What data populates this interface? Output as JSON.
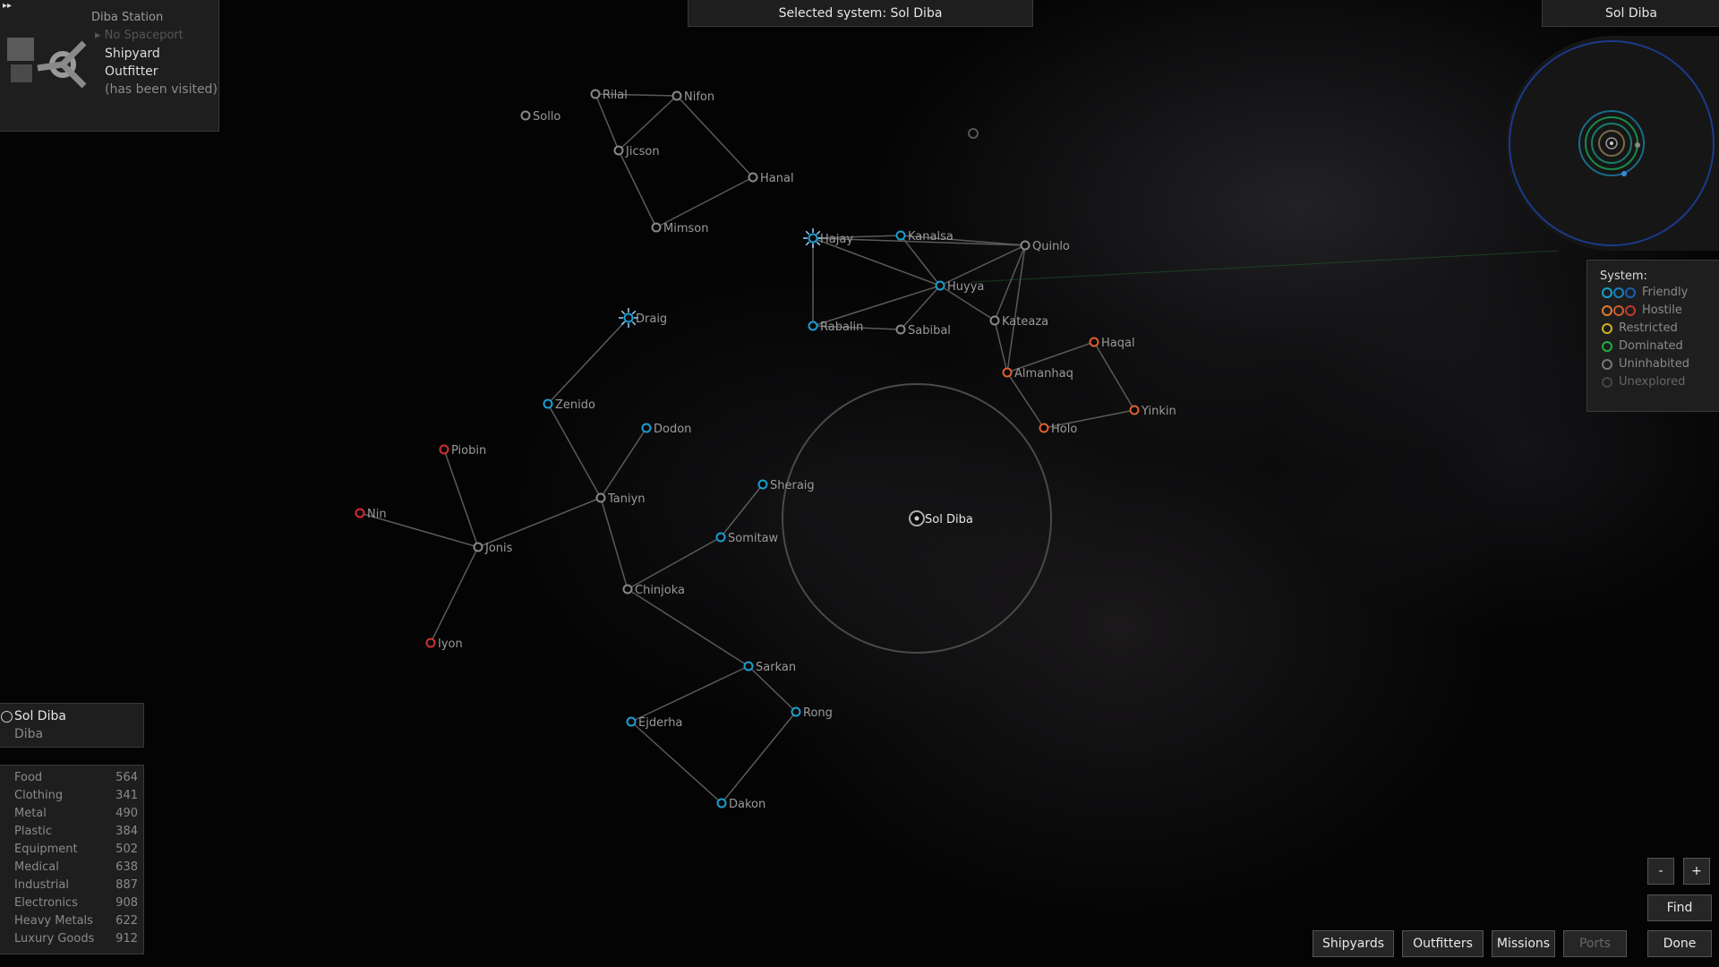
{
  "top_bar": {
    "selected_label": "Selected system: Sol Diba"
  },
  "planet_panel": {
    "station": "Diba Station",
    "spaceport": "No Spaceport",
    "shipyard": "Shipyard",
    "outfitter": "Outfitter",
    "visited": "(has been visited)"
  },
  "orbit_panel": {
    "title": "Sol Diba"
  },
  "legend": {
    "title": "System:",
    "items": [
      {
        "label": "Friendly",
        "colors": [
          "#1a9fd0",
          "#1a7fc0",
          "#1a5fb0"
        ]
      },
      {
        "label": "Hostile",
        "colors": [
          "#e07a30",
          "#d05a2a",
          "#c03a2a"
        ]
      },
      {
        "label": "Restricted",
        "colors": [
          "#d0b020"
        ]
      },
      {
        "label": "Dominated",
        "colors": [
          "#20b040"
        ]
      },
      {
        "label": "Uninhabited",
        "colors": [
          "#777777"
        ]
      },
      {
        "label": "Unexplored",
        "colors": [
          "#444444"
        ]
      }
    ]
  },
  "system_info": {
    "name": "Sol Diba",
    "government": "Diba"
  },
  "trade": [
    {
      "name": "Food",
      "price": "564"
    },
    {
      "name": "Clothing",
      "price": "341"
    },
    {
      "name": "Metal",
      "price": "490"
    },
    {
      "name": "Plastic",
      "price": "384"
    },
    {
      "name": "Equipment",
      "price": "502"
    },
    {
      "name": "Medical",
      "price": "638"
    },
    {
      "name": "Industrial",
      "price": "887"
    },
    {
      "name": "Electronics",
      "price": "908"
    },
    {
      "name": "Heavy Metals",
      "price": "622"
    },
    {
      "name": "Luxury Goods",
      "price": "912"
    }
  ],
  "zoom": {
    "minus": "-",
    "plus": "+"
  },
  "buttons": {
    "find": "Find",
    "shipyards": "Shipyards",
    "outfitters": "Outfitters",
    "missions": "Missions",
    "ports": "Ports",
    "done": "Done"
  },
  "colors": {
    "friendly": "#1a9fd0",
    "hostile_red": "#d03030",
    "hostile_orange": "#e06030",
    "uninhabited": "#888888",
    "selected": "#aaaaaa"
  },
  "systems": [
    {
      "name": "Sollo",
      "type": "uninhabited"
    },
    {
      "name": "Rilal",
      "type": "uninhabited"
    },
    {
      "name": "Nifon",
      "type": "uninhabited"
    },
    {
      "name": "Jicson",
      "type": "uninhabited"
    },
    {
      "name": "Hanal",
      "type": "uninhabited"
    },
    {
      "name": "Mimson",
      "type": "uninhabited"
    },
    {
      "name": "Hajay",
      "type": "friendly"
    },
    {
      "name": "Kanalsa",
      "type": "friendly"
    },
    {
      "name": "Quinlo",
      "type": "uninhabited"
    },
    {
      "name": "Huyya",
      "type": "friendly"
    },
    {
      "name": "Rabalin",
      "type": "friendly"
    },
    {
      "name": "Sabibal",
      "type": "uninhabited"
    },
    {
      "name": "Kateaza",
      "type": "uninhabited"
    },
    {
      "name": "Haqal",
      "type": "hostile_orange"
    },
    {
      "name": "Almanhaq",
      "type": "hostile_orange"
    },
    {
      "name": "Yinkin",
      "type": "hostile_orange"
    },
    {
      "name": "Holo",
      "type": "hostile_orange"
    },
    {
      "name": "Draig",
      "type": "friendly"
    },
    {
      "name": "Zenido",
      "type": "friendly"
    },
    {
      "name": "Dodon",
      "type": "friendly"
    },
    {
      "name": "Piobin",
      "type": "hostile_red"
    },
    {
      "name": "Nin",
      "type": "hostile_red"
    },
    {
      "name": "Jonis",
      "type": "uninhabited"
    },
    {
      "name": "Taniyn",
      "type": "uninhabited"
    },
    {
      "name": "Sheraig",
      "type": "friendly"
    },
    {
      "name": "Somitaw",
      "type": "friendly"
    },
    {
      "name": "Chinjoka",
      "type": "uninhabited"
    },
    {
      "name": "Iyon",
      "type": "hostile_red"
    },
    {
      "name": "Sarkan",
      "type": "friendly"
    },
    {
      "name": "Ejderha",
      "type": "friendly"
    },
    {
      "name": "Rong",
      "type": "friendly"
    },
    {
      "name": "Dakon",
      "type": "friendly"
    },
    {
      "name": "Sol Diba",
      "type": "selected"
    }
  ],
  "links": [
    [
      "Rilal",
      "Nifon"
    ],
    [
      "Rilal",
      "Jicson"
    ],
    [
      "Nifon",
      "Jicson"
    ],
    [
      "Nifon",
      "Hanal"
    ],
    [
      "Jicson",
      "Mimson"
    ],
    [
      "Hanal",
      "Mimson"
    ],
    [
      "Hajay",
      "Kanalsa"
    ],
    [
      "Hajay",
      "Huyya"
    ],
    [
      "Hajay",
      "Rabalin"
    ],
    [
      "Hajay",
      "Quinlo"
    ],
    [
      "Kanalsa",
      "Huyya"
    ],
    [
      "Huyya",
      "Quinlo"
    ],
    [
      "Huyya",
      "Kateaza"
    ],
    [
      "Huyya",
      "Rabalin"
    ],
    [
      "Huyya",
      "Sabibal"
    ],
    [
      "Rabalin",
      "Sabibal"
    ],
    [
      "Kanalsa",
      "Quinlo"
    ],
    [
      "Quinlo",
      "Kateaza"
    ],
    [
      "Quinlo",
      "Almanhaq"
    ],
    [
      "Kateaza",
      "Almanhaq"
    ],
    [
      "Almanhaq",
      "Haqal"
    ],
    [
      "Almanhaq",
      "Holo"
    ],
    [
      "Haqal",
      "Yinkin"
    ],
    [
      "Holo",
      "Yinkin"
    ],
    [
      "Draig",
      "Zenido"
    ],
    [
      "Zenido",
      "Taniyn"
    ],
    [
      "Dodon",
      "Taniyn"
    ],
    [
      "Taniyn",
      "Jonis"
    ],
    [
      "Taniyn",
      "Chinjoka"
    ],
    [
      "Piobin",
      "Jonis"
    ],
    [
      "Nin",
      "Jonis"
    ],
    [
      "Jonis",
      "Iyon"
    ],
    [
      "Sheraig",
      "Somitaw"
    ],
    [
      "Somitaw",
      "Chinjoka"
    ],
    [
      "Chinjoka",
      "Sarkan"
    ],
    [
      "Sarkan",
      "Ejderha"
    ],
    [
      "Sarkan",
      "Rong"
    ],
    [
      "Ejderha",
      "Dakon"
    ],
    [
      "Rong",
      "Dakon"
    ]
  ]
}
